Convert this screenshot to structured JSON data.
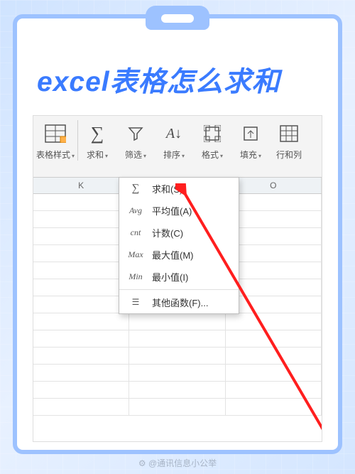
{
  "title": "excel表格怎么求和",
  "ribbon": [
    {
      "label": "表格样式",
      "icon": "table-style-icon"
    },
    {
      "label": "求和",
      "icon": "sigma-icon"
    },
    {
      "label": "筛选",
      "icon": "filter-icon"
    },
    {
      "label": "排序",
      "icon": "sort-icon"
    },
    {
      "label": "格式",
      "icon": "format-icon"
    },
    {
      "label": "填充",
      "icon": "fill-icon"
    },
    {
      "label": "行和列",
      "icon": "rows-cols-icon"
    }
  ],
  "columns": [
    "K",
    "",
    "O"
  ],
  "menu": [
    {
      "ico": "∑",
      "label": "求和(S)"
    },
    {
      "ico": "Avg",
      "label": "平均值(A)"
    },
    {
      "ico": "cnt",
      "label": "计数(C)"
    },
    {
      "ico": "Max",
      "label": "最大值(M)"
    },
    {
      "ico": "Min",
      "label": "最小值(I)"
    },
    {
      "ico": "☰",
      "label": "其他函数(F)..."
    }
  ],
  "watermark": "⚙ @通讯信息小公举"
}
